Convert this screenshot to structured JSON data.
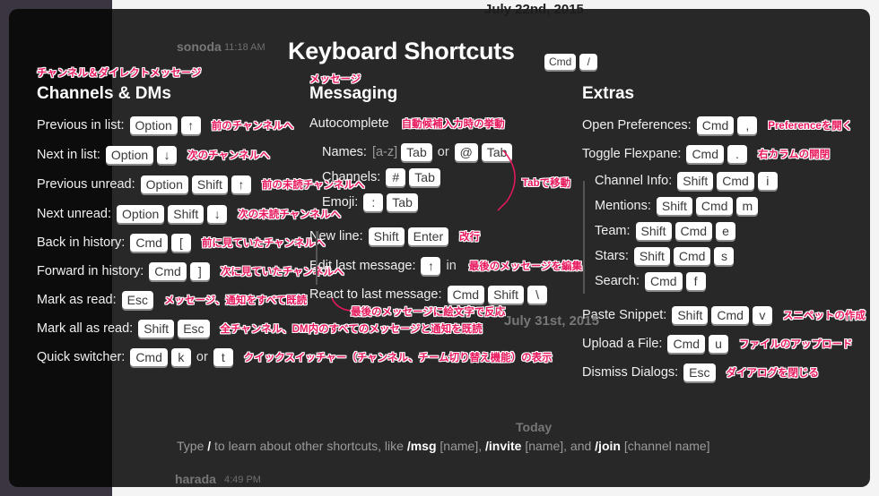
{
  "background": {
    "date_header": "July 22nd, 2015",
    "user1": "sonoda",
    "user1_time": "11:18 AM",
    "date_header2": "July 31st, 2015",
    "today": "Today",
    "user2": "harada",
    "user2_time": "4:49 PM"
  },
  "dialog": {
    "title": "Keyboard Shortcuts",
    "title_keys": [
      "Cmd",
      "/"
    ]
  },
  "colors": {
    "annotation": "#e8185c",
    "key_bg": "#ffffff",
    "overlay": "#1c1c1c"
  },
  "columns": [
    {
      "heading": "Channels & DMs",
      "heading_note": "チャンネル＆ダイレクトメッセージ",
      "rows": [
        {
          "label": "Previous in list:",
          "tokens": [
            {
              "key": "Option"
            },
            {
              "key": "↑"
            }
          ],
          "note": "前のチャンネルへ"
        },
        {
          "label": "Next in list:",
          "tokens": [
            {
              "key": "Option"
            },
            {
              "key": "↓"
            }
          ],
          "note": "次のチャンネルへ"
        },
        {
          "label": "Previous unread:",
          "tokens": [
            {
              "key": "Option"
            },
            {
              "key": "Shift"
            },
            {
              "key": "↑"
            }
          ],
          "note": "前の未読チャンネルへ"
        },
        {
          "label": "Next unread:",
          "tokens": [
            {
              "key": "Option"
            },
            {
              "key": "Shift"
            },
            {
              "key": "↓"
            }
          ],
          "note": "次の未読チャンネルへ"
        },
        {
          "label": "Back in history:",
          "tokens": [
            {
              "key": "Cmd"
            },
            {
              "key": "["
            }
          ],
          "note": "前に見ていたチャンネルへ"
        },
        {
          "label": "Forward in history:",
          "tokens": [
            {
              "key": "Cmd"
            },
            {
              "key": "]"
            }
          ],
          "note": "次に見ていたチャンネルへ"
        },
        {
          "label": "Mark as read:",
          "tokens": [
            {
              "key": "Esc"
            }
          ],
          "note": "メッセージ、通知をすべて既読"
        },
        {
          "label": "Mark all as read:",
          "tokens": [
            {
              "key": "Shift"
            },
            {
              "key": "Esc"
            }
          ],
          "note": "全チャンネル、DM内のすべてのメッセージと通知を既読"
        },
        {
          "label": "Quick switcher:",
          "tokens": [
            {
              "key": "Cmd"
            },
            {
              "key": "k"
            },
            {
              "text": "or"
            },
            {
              "key": "t"
            }
          ],
          "note": "クイックスイッチャー（チャンネル、チーム切り替え機能）の表示"
        }
      ]
    },
    {
      "heading": "Messaging",
      "heading_note": "メッセージ",
      "rows": [
        {
          "label": "Autocomplete",
          "tokens": [],
          "note": "自動候補入力時の挙動"
        },
        {
          "label": "Names:",
          "tokens": [
            {
              "hint": "[a-z]"
            },
            {
              "key": "Tab"
            },
            {
              "text": "or"
            },
            {
              "key": "@"
            },
            {
              "key": "Tab"
            }
          ],
          "note": ""
        },
        {
          "label": "Channels:",
          "tokens": [
            {
              "key": "#"
            },
            {
              "key": "Tab"
            }
          ],
          "note": ""
        },
        {
          "label": "Emoji:",
          "tokens": [
            {
              "key": ":"
            },
            {
              "key": "Tab"
            }
          ],
          "note": ""
        },
        {
          "label": "New line:",
          "tokens": [
            {
              "key": "Shift"
            },
            {
              "key": "Enter"
            }
          ],
          "note": "改行"
        },
        {
          "label": "Edit last message:",
          "tokens": [
            {
              "key": "↑"
            },
            {
              "text": "in"
            }
          ],
          "note": "最後のメッセージを編集"
        },
        {
          "label": "React to last message:",
          "tokens": [
            {
              "key": "Cmd"
            },
            {
              "key": "Shift"
            },
            {
              "key": "\\"
            }
          ],
          "note": ""
        }
      ],
      "autocomplete_note": "Tabで移動",
      "react_note": "最後のメッセージに絵文字で反応"
    },
    {
      "heading": "Extras",
      "heading_note": "",
      "rows": [
        {
          "label": "Open Preferences:",
          "tokens": [
            {
              "key": "Cmd"
            },
            {
              "key": ","
            }
          ],
          "note": "Preferenceを開く"
        },
        {
          "label": "Toggle Flexpane:",
          "tokens": [
            {
              "key": "Cmd"
            },
            {
              "key": "."
            }
          ],
          "note": "右カラムの開閉"
        },
        {
          "label": "Channel Info:",
          "tokens": [
            {
              "key": "Shift"
            },
            {
              "key": "Cmd"
            },
            {
              "key": "i"
            }
          ],
          "note": ""
        },
        {
          "label": "Mentions:",
          "tokens": [
            {
              "key": "Shift"
            },
            {
              "key": "Cmd"
            },
            {
              "key": "m"
            }
          ],
          "note": ""
        },
        {
          "label": "Team:",
          "tokens": [
            {
              "key": "Shift"
            },
            {
              "key": "Cmd"
            },
            {
              "key": "e"
            }
          ],
          "note": ""
        },
        {
          "label": "Stars:",
          "tokens": [
            {
              "key": "Shift"
            },
            {
              "key": "Cmd"
            },
            {
              "key": "s"
            }
          ],
          "note": ""
        },
        {
          "label": "Search:",
          "tokens": [
            {
              "key": "Cmd"
            },
            {
              "key": "f"
            }
          ],
          "note": ""
        },
        {
          "label": "Paste Snippet:",
          "tokens": [
            {
              "key": "Shift"
            },
            {
              "key": "Cmd"
            },
            {
              "key": "v"
            }
          ],
          "note": "スニペットの作成"
        },
        {
          "label": "Upload a File:",
          "tokens": [
            {
              "key": "Cmd"
            },
            {
              "key": "u"
            }
          ],
          "note": "ファイルのアップロード"
        },
        {
          "label": "Dismiss Dialogs:",
          "tokens": [
            {
              "key": "Esc"
            }
          ],
          "note": "ダイアログを閉じる"
        }
      ]
    }
  ],
  "footer": {
    "p1": "Type ",
    "slash": "/",
    "p2": " to learn about other shortcuts, like ",
    "msg": "/msg",
    "msg_arg": " [name], ",
    "invite": "/invite",
    "invite_arg": " [name], and ",
    "join": "/join",
    "join_arg": " [channel name]"
  }
}
